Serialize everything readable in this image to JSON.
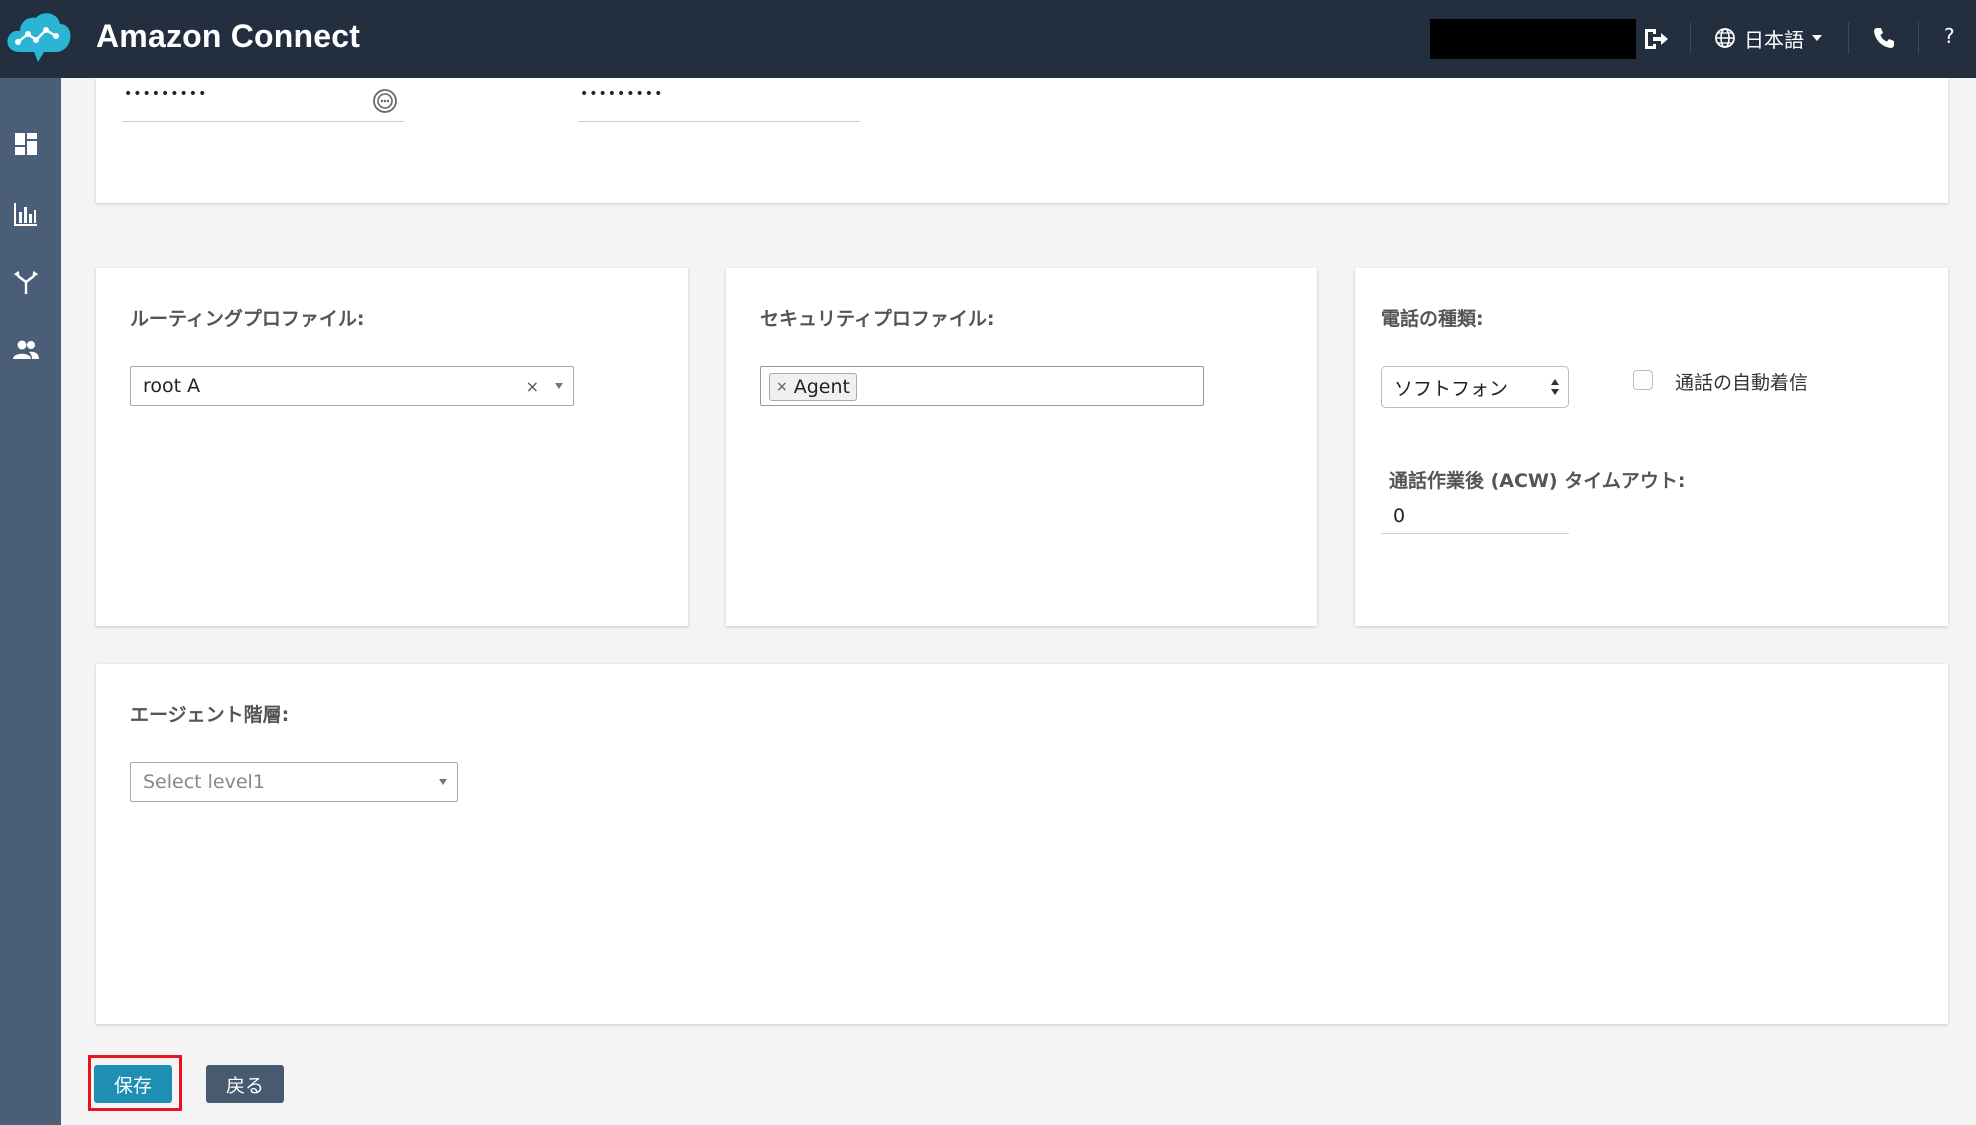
{
  "header": {
    "title": "Amazon Connect",
    "language": "日本語",
    "help": "?"
  },
  "icons": {
    "logo": "cloud-logo-icon",
    "logout": "logout-icon",
    "globe": "globe-icon",
    "phone": "phone-icon",
    "nav": [
      "dashboard-icon",
      "metrics-icon",
      "routing-icon",
      "users-icon"
    ]
  },
  "credentials": {
    "password": "•••••••••",
    "password_confirm": "•••••••••"
  },
  "routing": {
    "label": "ルーティングプロファイル:",
    "value": "root A",
    "clear": "×"
  },
  "security": {
    "label": "セキュリティプロファイル:",
    "tag": "Agent",
    "tag_remove": "×"
  },
  "phone": {
    "label": "電話の種類:",
    "type": "ソフトフォン",
    "auto_accept_label": "通話の自動着信",
    "auto_accept_checked": false,
    "acw_label": "通話作業後 (ACW) タイムアウト:",
    "acw_value": "0"
  },
  "hierarchy": {
    "label": "エージェント階層:",
    "placeholder": "Select level1"
  },
  "actions": {
    "save": "保存",
    "back": "戻る"
  },
  "colors": {
    "header_bg": "#232f3e",
    "sidebar_bg": "#4a5e78",
    "save_btn": "#1e8fb3",
    "back_btn": "#475a70",
    "highlight": "#e8131b",
    "logo": "#2bb5d4"
  }
}
